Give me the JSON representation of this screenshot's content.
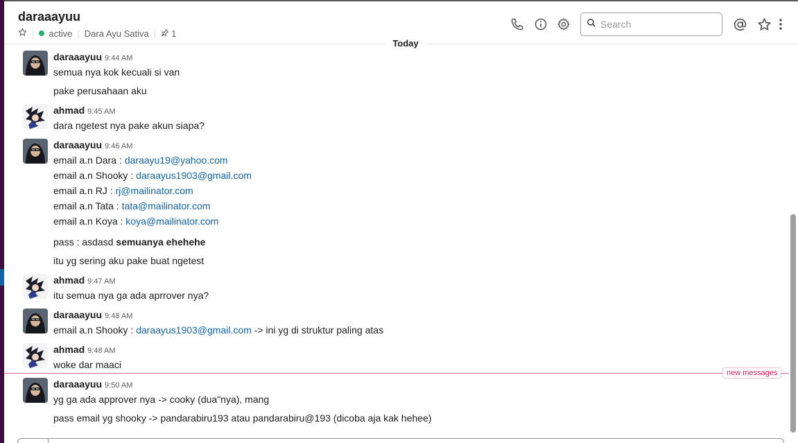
{
  "channel": {
    "name": "daraaayuu",
    "status": "active",
    "full_name": "Dara Ayu Sativa",
    "pins": "1"
  },
  "search": {
    "placeholder": "Search"
  },
  "day_divider": "Today",
  "new_messages_label": "new messages",
  "messages": [
    {
      "author": "daraaayuu",
      "time": "9:44 AM",
      "lines": [
        "semua nya kok kecuali si van",
        "pake perusahaan aku"
      ]
    },
    {
      "author": "ahmad",
      "time": "9:45 AM",
      "lines": [
        "dara ngetest nya pake akun siapa?"
      ]
    },
    {
      "author": "daraaayuu",
      "time": "9:46 AM",
      "emails": [
        {
          "prefix": "email a.n Dara : ",
          "email": "daraayu19@yahoo.com"
        },
        {
          "prefix": "email a.n Shooky : ",
          "email": "daraayus1903@gmail.com"
        },
        {
          "prefix": "email a.n RJ : ",
          "email": "rj@mailinator.com"
        },
        {
          "prefix": "email a.n Tata : ",
          "email": "tata@mailinator.com"
        },
        {
          "prefix": "email a.n Koya : ",
          "email": "koya@mailinator.com"
        }
      ],
      "pass_prefix": "pass : asdasd ",
      "pass_bold": "semuanya ehehehe",
      "extra": "itu yg sering aku pake buat ngetest"
    },
    {
      "author": "ahmad",
      "time": "9:47 AM",
      "lines": [
        "itu semua nya ga ada aprrover nya?"
      ]
    },
    {
      "author": "daraaayuu",
      "time": "9:48 AM",
      "prefix": "email a.n Shooky : ",
      "email": "daraayus1903@gmail.com",
      "suffix": " -> ini yg di struktur paling atas"
    },
    {
      "author": "ahmad",
      "time": "9:48 AM",
      "lines": [
        "woke dar maaci"
      ]
    },
    {
      "author": "daraaayuu",
      "time": "9:50 AM",
      "lines": [
        "yg ga ada approver nya -> cooky (dua\"nya), mang",
        "pass email yg shooky -> pandarabiru193 atau pandarabiru@193 (dicoba aja kak hehee)"
      ]
    }
  ]
}
